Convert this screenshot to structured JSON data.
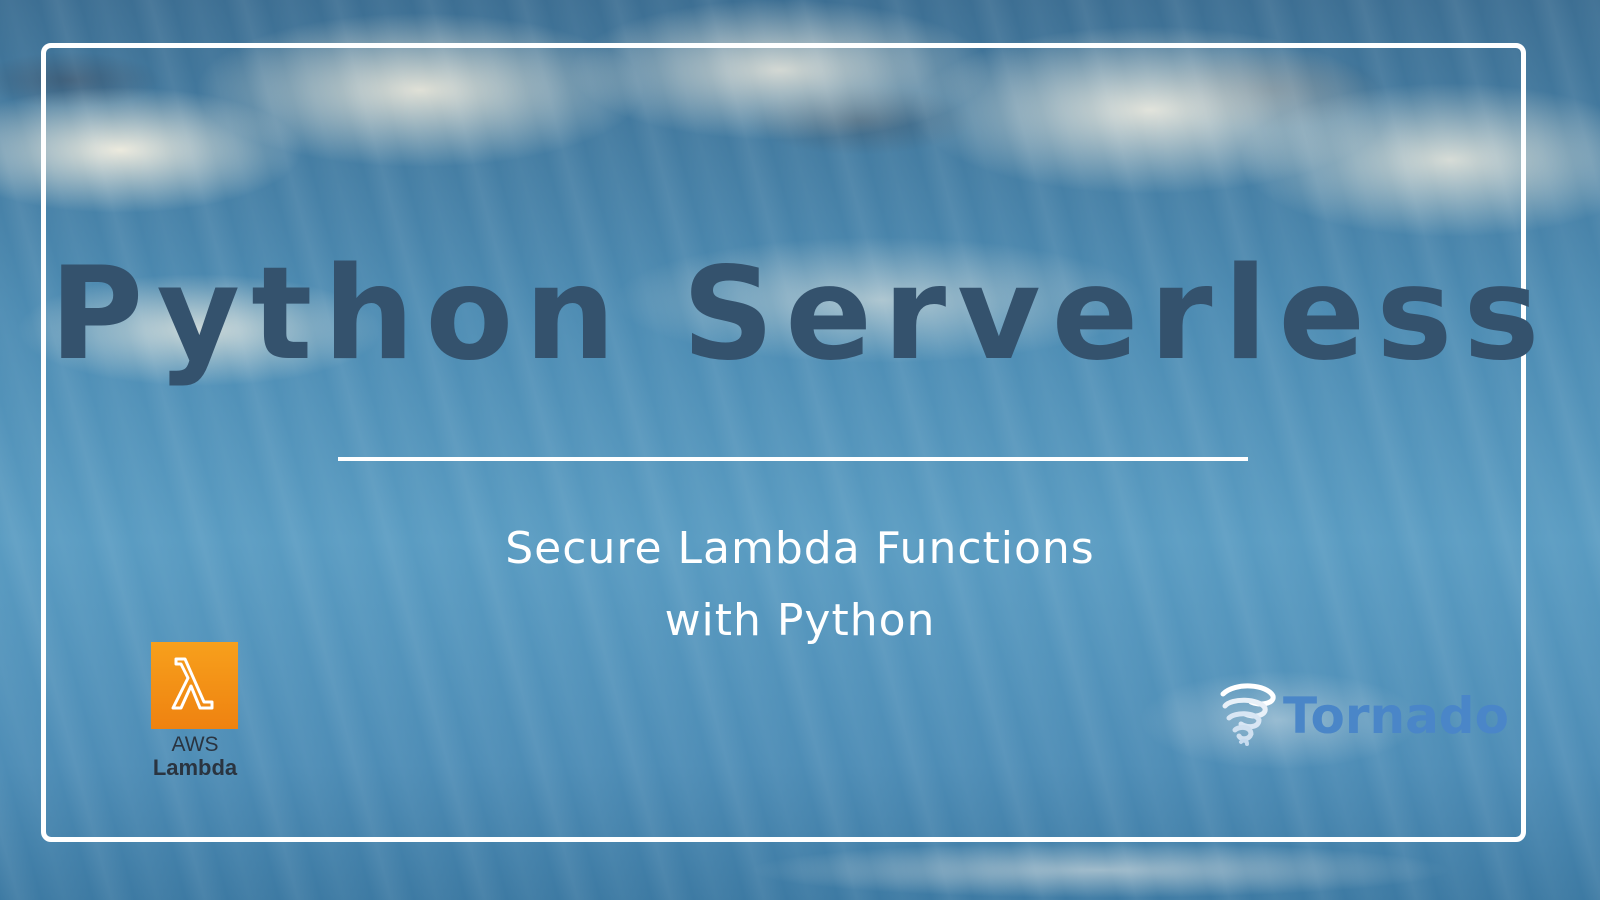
{
  "banner": {
    "title": "Python Serverless",
    "subtitle_line1": "Secure Lambda Functions",
    "subtitle_line2": "with Python"
  },
  "aws_logo": {
    "icon": "lambda-icon",
    "line1": "AWS",
    "line2": "Lambda",
    "color": "#f7941d"
  },
  "tornado_logo": {
    "icon": "tornado-icon",
    "text": "Tornado",
    "color": "#4a86c8"
  },
  "colors": {
    "title": "#34526d",
    "frame": "#ffffff",
    "sky": "#4d8cb3"
  }
}
